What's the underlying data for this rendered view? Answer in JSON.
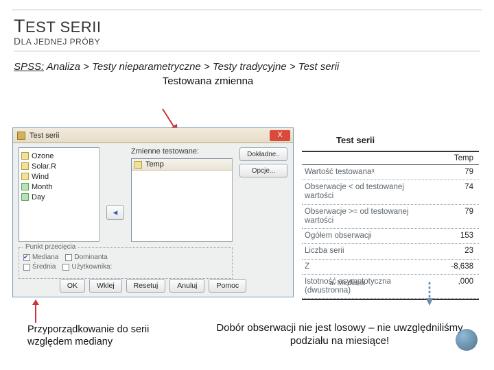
{
  "titles": {
    "main_caps": "T",
    "main_rest": "EST SERII",
    "sub_caps": "D",
    "sub_rest": "LA JEDNEJ PRÓBY"
  },
  "spss_path": {
    "prefix": "SPSS:",
    "rest": " Analiza > Testy nieparametryczne > Testy tradycyjne > Test serii"
  },
  "labels": {
    "tested_variable": "Testowana zmienna",
    "assign_median": "Przyporządkowanie do serii względem mediany",
    "conclusion": "Dobór obserwacji nie jest losowy – nie uwzględniliśmy podziału na miesiące!"
  },
  "dialog": {
    "title": "Test serii",
    "vars_left": [
      "Ozone",
      "Solar.R",
      "Wind",
      "Month",
      "Day"
    ],
    "tested_label": "Zmienne testowane:",
    "var_selected": "Temp",
    "side_buttons": {
      "exact": "Dokładne..",
      "options": "Opcje..."
    },
    "transfer_arrow": "◂",
    "cutpoint": {
      "group_title": "Punkt przecięcia",
      "opts": [
        {
          "label": "Mediana",
          "checked": true
        },
        {
          "label": "Dominanta",
          "checked": false
        },
        {
          "label": "Średnia",
          "checked": false
        },
        {
          "label": "Użytkownika:",
          "checked": false
        }
      ]
    },
    "buttons": [
      "OK",
      "Wklej",
      "Resetuj",
      "Anuluj",
      "Pomoc"
    ],
    "close": "X"
  },
  "results": {
    "title": "Test serii",
    "column": "Temp",
    "rows": [
      {
        "label": "Wartość testowanaᵃ",
        "value": "79"
      },
      {
        "label": "Obserwacje < od testowanej wartości",
        "value": "74"
      },
      {
        "label": "Obserwacje >= od testowanej wartości",
        "value": "79"
      },
      {
        "label": "Ogółem obserwacji",
        "value": "153"
      },
      {
        "label": "Liczba serii",
        "value": "23"
      },
      {
        "label": "Z",
        "value": "-8,638"
      },
      {
        "label": "Istotność asymptotyczna (dwustronna)",
        "value": ",000"
      }
    ],
    "footnote": "a. Mediana"
  }
}
